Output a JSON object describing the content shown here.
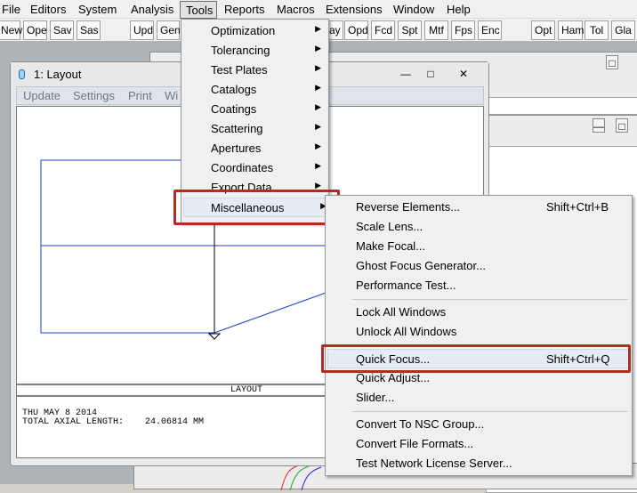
{
  "menubar": [
    "File",
    "Editors",
    "System",
    "Analysis",
    "Tools",
    "Reports",
    "Macros",
    "Extensions",
    "Window",
    "Help"
  ],
  "toolbar_left": [
    "New",
    "Ope",
    "Sav",
    "Sas",
    "Upd",
    "Gen"
  ],
  "toolbar_right": [
    "ay",
    "Opd",
    "Fcd",
    "Spt",
    "Mtf",
    "Fps",
    "Enc",
    "Opt",
    "Ham",
    "Tol",
    "Gla"
  ],
  "layout_window": {
    "title": "1: Layout",
    "controls": [
      "—",
      "□",
      "✕"
    ],
    "menu": [
      "Update",
      "Settings",
      "Print",
      "Wi"
    ],
    "plot_label": "LAYOUT",
    "date_line": "THU MAY 8 2014",
    "length_line": "TOTAL AXIAL LENGTH:    24.06814 MM"
  },
  "tools_menu": [
    "Optimization",
    "Tolerancing",
    "Test Plates",
    "Catalogs",
    "Coatings",
    "Scattering",
    "Apertures",
    "Coordinates",
    "Export Data",
    "Miscellaneous"
  ],
  "misc_menu": {
    "reverse": "Reverse Elements...",
    "reverse_sc": "Shift+Ctrl+B",
    "scale": "Scale Lens...",
    "focal": "Make Focal...",
    "ghost": "Ghost Focus Generator...",
    "perf": "Performance Test...",
    "lock": "Lock All Windows",
    "unlock": "Unlock All Windows",
    "qfocus": "Quick Focus...",
    "qfocus_sc": "Shift+Ctrl+Q",
    "qadjust": "Quick Adjust...",
    "slider": "Slider...",
    "nsc": "Convert To NSC Group...",
    "formats": "Convert File Formats...",
    "license": "Test Network License Server..."
  },
  "highlight_color": "#b12d1f",
  "ray_color": "#1c3fbf"
}
